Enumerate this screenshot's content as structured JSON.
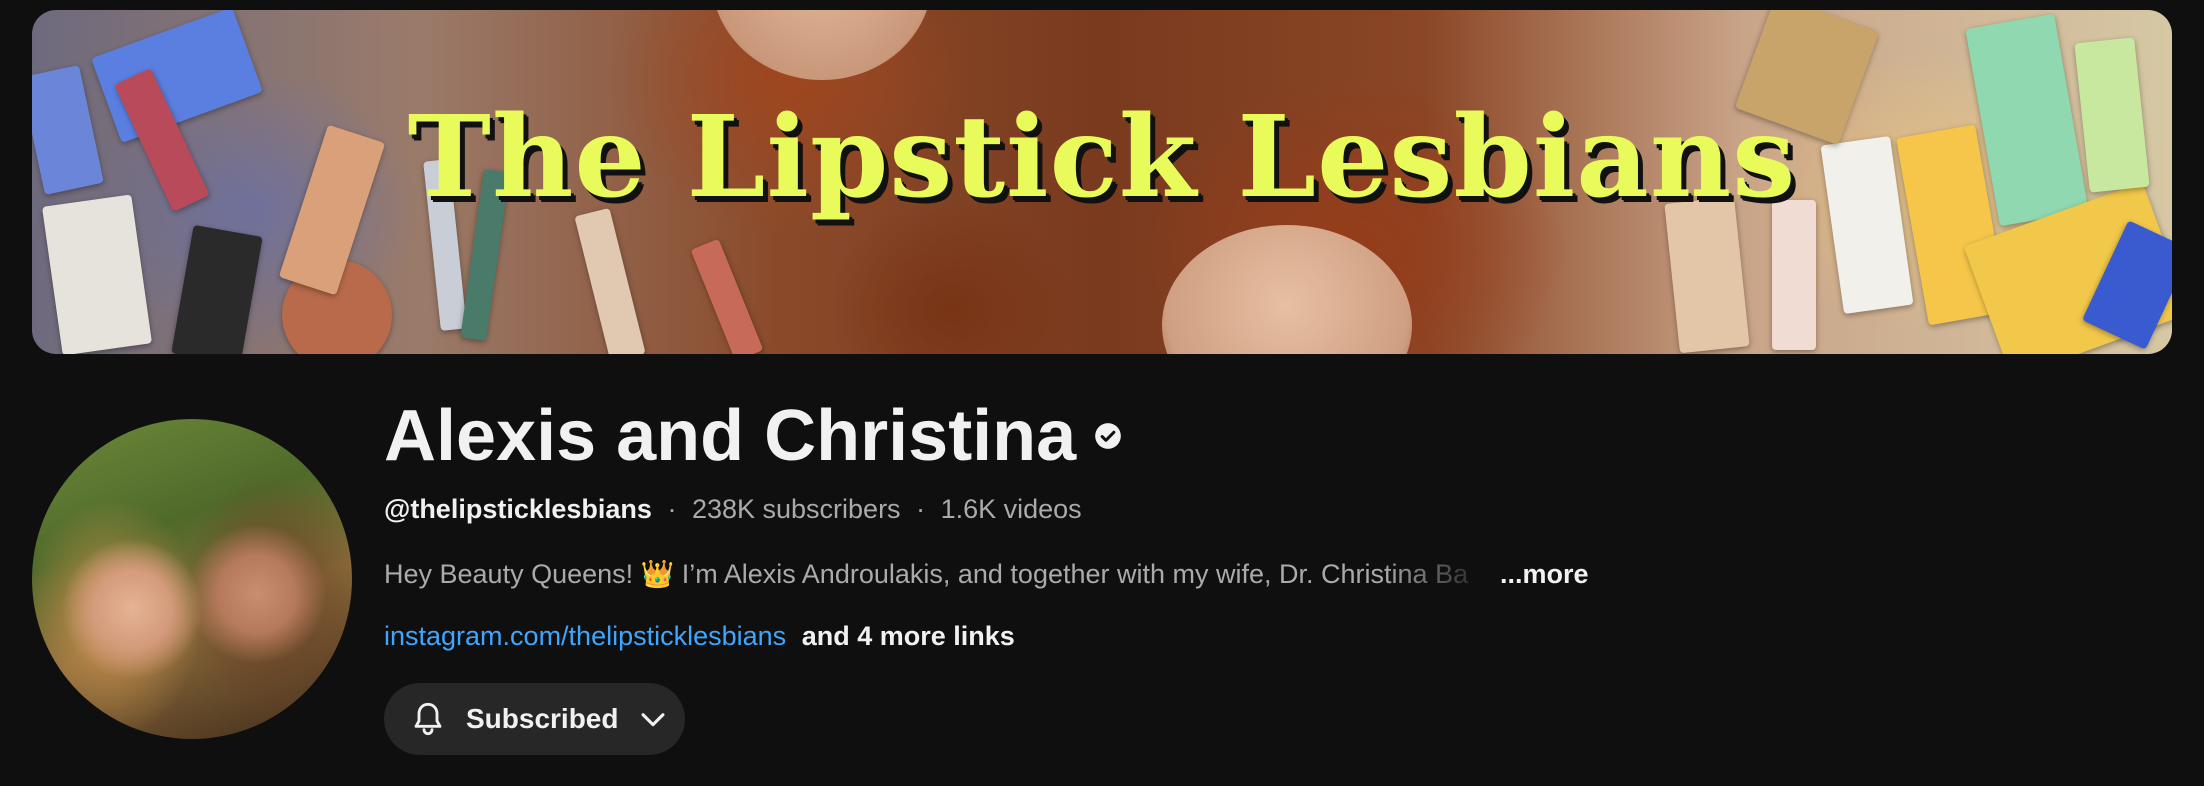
{
  "banner": {
    "title": "The Lipstick Lesbians"
  },
  "channel": {
    "name": "Alexis and Christina",
    "handle": "@thelipsticklesbians",
    "subscribers": "238K subscribers",
    "videos": "1.6K videos",
    "separator": "·",
    "description": "Hey Beauty Queens! 👑 I’m Alexis Androulakis, and together with my wife, Dr. Christina Ba",
    "more_label": "...more",
    "link_primary": "instagram.com/thelipsticklesbians",
    "link_more": "and 4 more links"
  },
  "subscribe_button": {
    "label": "Subscribed"
  },
  "icons": {
    "verified": "verified-check-icon",
    "bell": "bell-icon",
    "chevron": "chevron-down-icon"
  },
  "colors": {
    "background": "#0f0f0f",
    "link": "#3ea6ff",
    "button_bg": "#272727",
    "banner_title": "#e8fb5a"
  }
}
